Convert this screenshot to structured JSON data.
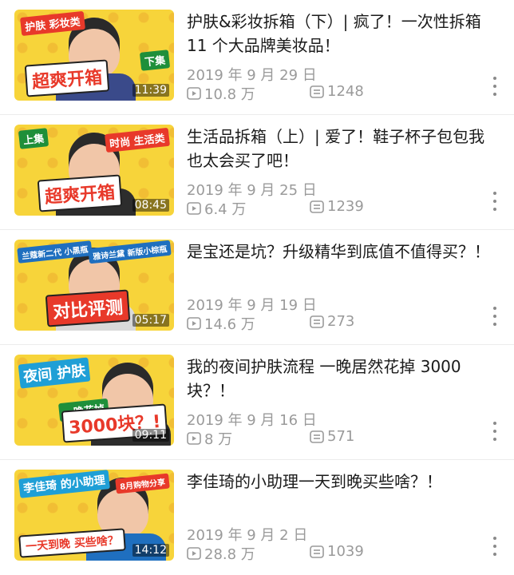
{
  "videos": [
    {
      "title": "护肤&彩妆拆箱（下）| 疯了！一次性拆箱 11 个大品牌美妆品！",
      "date": "2019 年 9 月 29 日",
      "views": "10.8 万",
      "comments": "1248",
      "duration": "11:39",
      "thumb_tag_a": "护肤 彩妆类",
      "thumb_tag_b": "下集",
      "thumb_big": "超爽开箱"
    },
    {
      "title": "生活品拆箱（上）| 爱了！鞋子杯子包包我也太会买了吧！",
      "date": "2019 年 9 月 25 日",
      "views": "6.4 万",
      "comments": "1239",
      "duration": "08:45",
      "thumb_tag_a": "上集",
      "thumb_tag_b": "时尚 生活类",
      "thumb_big": "超爽开箱"
    },
    {
      "title": "是宝还是坑？升级精华到底值不值得买？！",
      "date": "2019 年 9 月 19 日",
      "views": "14.6 万",
      "comments": "273",
      "duration": "05:17",
      "thumb_tag_a": "兰蔻新二代 小黑瓶",
      "thumb_tag_b": "雅诗兰黛 新版小棕瓶",
      "thumb_big": "对比评测"
    },
    {
      "title": "我的夜间护肤流程 一晚居然花掉 3000 块？！",
      "date": "2019 年 9 月 16 日",
      "views": "8 万",
      "comments": "571",
      "duration": "09:11",
      "thumb_tag_a": "夜间 护肤",
      "thumb_tag_b": "一晚花掉",
      "thumb_big": "3000块？!"
    },
    {
      "title": "李佳琦的小助理一天到晚买些啥？！",
      "date": "2019 年 9 月 2 日",
      "views": "28.8 万",
      "comments": "1039",
      "duration": "14:12",
      "thumb_tag_a": "李佳琦 的小助理",
      "thumb_tag_b": "8月购物分享",
      "thumb_big": "一天到晚 买些啥？"
    }
  ],
  "icons": {
    "views": "play-count-icon",
    "comments": "comment-icon",
    "more": "more-vertical-icon"
  },
  "colors": {
    "title": "#1b1b1b",
    "meta": "#9a9a9a",
    "thumb_bg": "#f7d43a",
    "thumb_accent": "#e8392a"
  }
}
